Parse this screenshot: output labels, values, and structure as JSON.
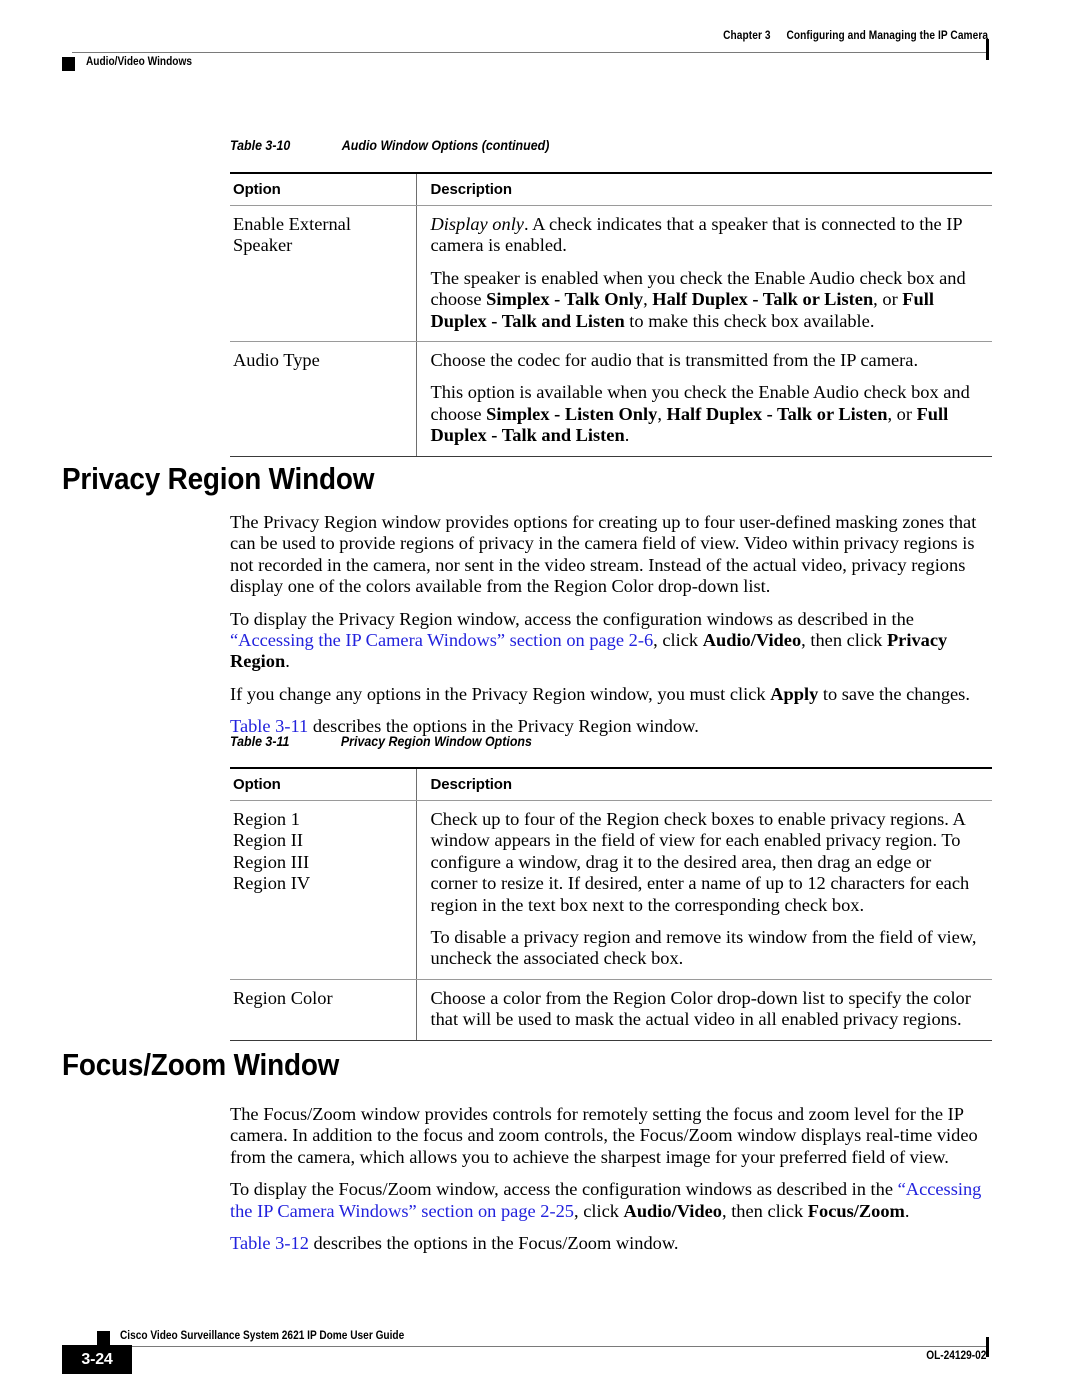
{
  "header": {
    "chapter": "Chapter 3",
    "title": "Configuring and Managing the IP Camera",
    "section": "Audio/Video Windows"
  },
  "table_3_10": {
    "caption_number": "Table 3-10",
    "caption_title": "Audio Window Options (continued)",
    "columns": [
      "Option",
      "Description"
    ],
    "rows": [
      {
        "option": "Enable External Speaker",
        "option_lines": [
          "Enable External",
          "Speaker"
        ],
        "description_paragraphs": [
          {
            "runs": [
              {
                "text": "Display only",
                "style": "italic"
              },
              {
                "text": ". A check indicates that a speaker that is connected to the IP camera is enabled.",
                "style": "normal"
              }
            ]
          },
          {
            "runs": [
              {
                "text": "The speaker is enabled when you check the Enable Audio check box and choose ",
                "style": "normal"
              },
              {
                "text": "Simplex - Talk Only",
                "style": "bold"
              },
              {
                "text": ", ",
                "style": "normal"
              },
              {
                "text": "Half Duplex - Talk or Listen",
                "style": "bold"
              },
              {
                "text": ", or ",
                "style": "normal"
              },
              {
                "text": "Full Duplex - Talk and Listen",
                "style": "bold"
              },
              {
                "text": " to make this check box available.",
                "style": "normal"
              }
            ]
          }
        ]
      },
      {
        "option": "Audio Type",
        "option_lines": [
          "Audio Type"
        ],
        "description_paragraphs": [
          {
            "runs": [
              {
                "text": "Choose the codec for audio that is transmitted from the IP camera.",
                "style": "normal"
              }
            ]
          },
          {
            "runs": [
              {
                "text": "This option is available when you check the Enable Audio check box and choose ",
                "style": "normal"
              },
              {
                "text": "Simplex - Listen Only",
                "style": "bold"
              },
              {
                "text": ", ",
                "style": "normal"
              },
              {
                "text": "Half Duplex - Talk or Listen",
                "style": "bold"
              },
              {
                "text": ", or ",
                "style": "normal"
              },
              {
                "text": "Full Duplex - Talk and Listen",
                "style": "bold"
              },
              {
                "text": ".",
                "style": "normal"
              }
            ]
          }
        ]
      }
    ]
  },
  "privacy_region_section": {
    "heading": "Privacy Region Window",
    "paragraphs": [
      {
        "runs": [
          {
            "text": "The Privacy Region window provides options for creating up to four user-defined masking zones that can be used to provide regions of privacy in the camera field of view. Video within privacy regions is not recorded in the camera, nor sent in the video stream. Instead of the actual video, privacy regions display one of the colors available from the Region Color drop-down list.",
            "style": "normal"
          }
        ]
      },
      {
        "runs": [
          {
            "text": "To display the Privacy Region window, access the configuration windows as described in the ",
            "style": "normal"
          },
          {
            "text": "“Accessing the IP Camera Windows” section on page 2-6",
            "style": "link"
          },
          {
            "text": ", click ",
            "style": "normal"
          },
          {
            "text": "Audio/Video",
            "style": "bold"
          },
          {
            "text": ", then click ",
            "style": "normal"
          },
          {
            "text": "Privacy Region",
            "style": "bold"
          },
          {
            "text": ".",
            "style": "normal"
          }
        ]
      },
      {
        "runs": [
          {
            "text": "If you change any options in the Privacy Region window, you must click ",
            "style": "normal"
          },
          {
            "text": "Apply",
            "style": "bold"
          },
          {
            "text": " to save the changes.",
            "style": "normal"
          }
        ]
      },
      {
        "runs": [
          {
            "text": "Table 3-11",
            "style": "link"
          },
          {
            "text": " describes the options in the Privacy Region window.",
            "style": "normal"
          }
        ]
      }
    ]
  },
  "table_3_11": {
    "caption_number": "Table 3-11",
    "caption_title": "Privacy Region Window Options",
    "columns": [
      "Option",
      "Description"
    ],
    "rows": [
      {
        "option": "Region 1 Region II Region III Region IV",
        "option_lines": [
          "Region 1",
          "Region II",
          "Region III",
          "Region IV"
        ],
        "description_paragraphs": [
          {
            "runs": [
              {
                "text": "Check up to four of the Region check boxes to enable privacy regions. A window appears in the field of view for each enabled privacy region. To configure a window, drag it to the desired area, then drag an edge or corner to resize it. If desired, enter a name of up to 12 characters for each region in the text box next to the corresponding check box.",
                "style": "normal"
              }
            ]
          },
          {
            "runs": [
              {
                "text": "To disable a privacy region and remove its window from the field of view, uncheck the associated check box.",
                "style": "normal"
              }
            ]
          }
        ]
      },
      {
        "option": "Region Color",
        "option_lines": [
          "Region Color"
        ],
        "description_paragraphs": [
          {
            "runs": [
              {
                "text": "Choose a color from the Region Color drop-down list to specify the color that will be used to mask the actual video in all enabled privacy regions.",
                "style": "normal"
              }
            ]
          }
        ]
      }
    ]
  },
  "focus_zoom_section": {
    "heading": "Focus/Zoom Window",
    "paragraphs": [
      {
        "runs": [
          {
            "text": "The Focus/Zoom window provides controls for remotely setting the focus and zoom level for the IP camera. In addition to the focus and zoom controls, the Focus/Zoom window displays real-time video from the camera, which allows you to achieve the sharpest image for your preferred field of view.",
            "style": "normal"
          }
        ]
      },
      {
        "runs": [
          {
            "text": "To display the Focus/Zoom window, access the configuration windows as described in the ",
            "style": "normal"
          },
          {
            "text": "“Accessing the IP Camera Windows” section on page 2-25",
            "style": "link"
          },
          {
            "text": ", click ",
            "style": "normal"
          },
          {
            "text": "Audio/Video",
            "style": "bold"
          },
          {
            "text": ", then click ",
            "style": "normal"
          },
          {
            "text": "Focus/Zoom",
            "style": "bold"
          },
          {
            "text": ".",
            "style": "normal"
          }
        ]
      },
      {
        "runs": [
          {
            "text": "Table 3-12",
            "style": "link"
          },
          {
            "text": " describes the options in the Focus/Zoom window.",
            "style": "normal"
          }
        ]
      }
    ]
  },
  "footer": {
    "page_number": "3-24",
    "guide_title": "Cisco Video Surveillance System 2621 IP Dome User Guide",
    "doc_id": "OL-24129-02"
  },
  "colors": {
    "link": "#2222dd",
    "text": "#000000",
    "rule": "#7a7a7a"
  }
}
